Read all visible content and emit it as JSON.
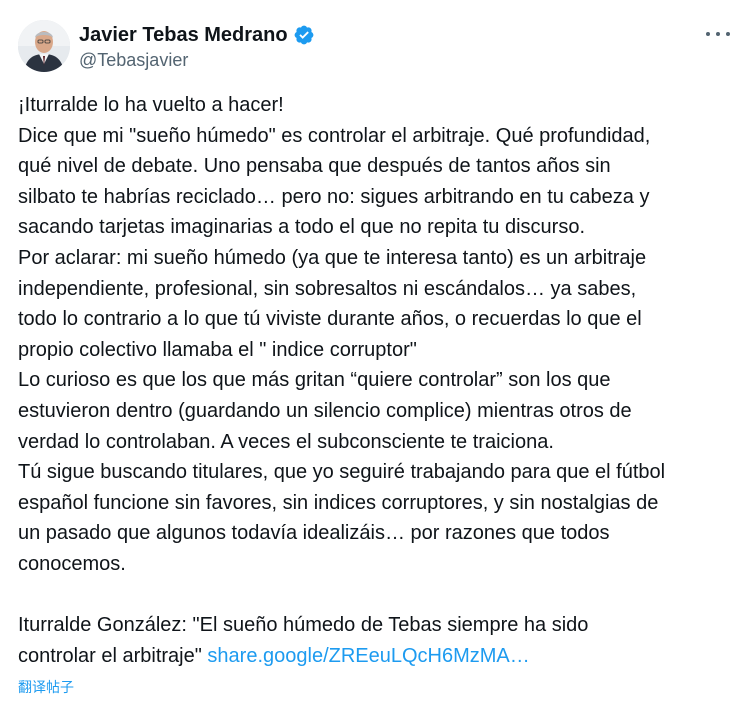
{
  "author": {
    "display_name": "Javier Tebas Medrano",
    "handle": "@Tebasjavier",
    "verified": true,
    "avatar_icon": "avatar-photo"
  },
  "menu_icon": "more-options-icon",
  "colors": {
    "text": "#0f1419",
    "secondary": "#536471",
    "link": "#1d9bf0",
    "verified_badge": "#1d9bf0"
  },
  "tweet": {
    "lines": [
      "¡Iturralde lo ha vuelto a hacer!",
      "Dice que mi \"sueño húmedo\" es controlar el arbitraje. Qué profundidad,",
      "qué nivel de debate. Uno pensaba que después de tantos años sin",
      "silbato te habrías reciclado… pero no: sigues arbitrando en tu cabeza y",
      "sacando tarjetas imaginarias a todo el que no repita tu discurso.",
      "Por aclarar: mi sueño húmedo (ya que te interesa tanto) es un arbitraje",
      "independiente, profesional, sin sobresaltos ni escándalos… ya sabes,",
      "todo lo contrario a lo que tú viviste durante años, o recuerdas lo que el",
      "propio colectivo llamaba el \" indice corruptor\"",
      "Lo curioso es que los que más gritan “quiere controlar” son los que",
      "estuvieron dentro (guardando un silencio complice) mientras otros de",
      "verdad lo controlaban. A veces el subconsciente te traiciona.",
      "Tú sigue buscando titulares, que yo seguiré trabajando para que el fútbol",
      "español funcione sin favores, sin indices corruptores, y sin nostalgias de",
      "un pasado que algunos todavía idealizáis… por razones que todos",
      "conocemos."
    ],
    "quote_line_1": "Iturralde González: \"El sueño húmedo de Tebas siempre ha sido",
    "quote_line_2": "controlar el arbitraje\"",
    "link_text": "share.google/ZREeuLQcH6MzMA…"
  },
  "translate_label": "翻译帖子"
}
